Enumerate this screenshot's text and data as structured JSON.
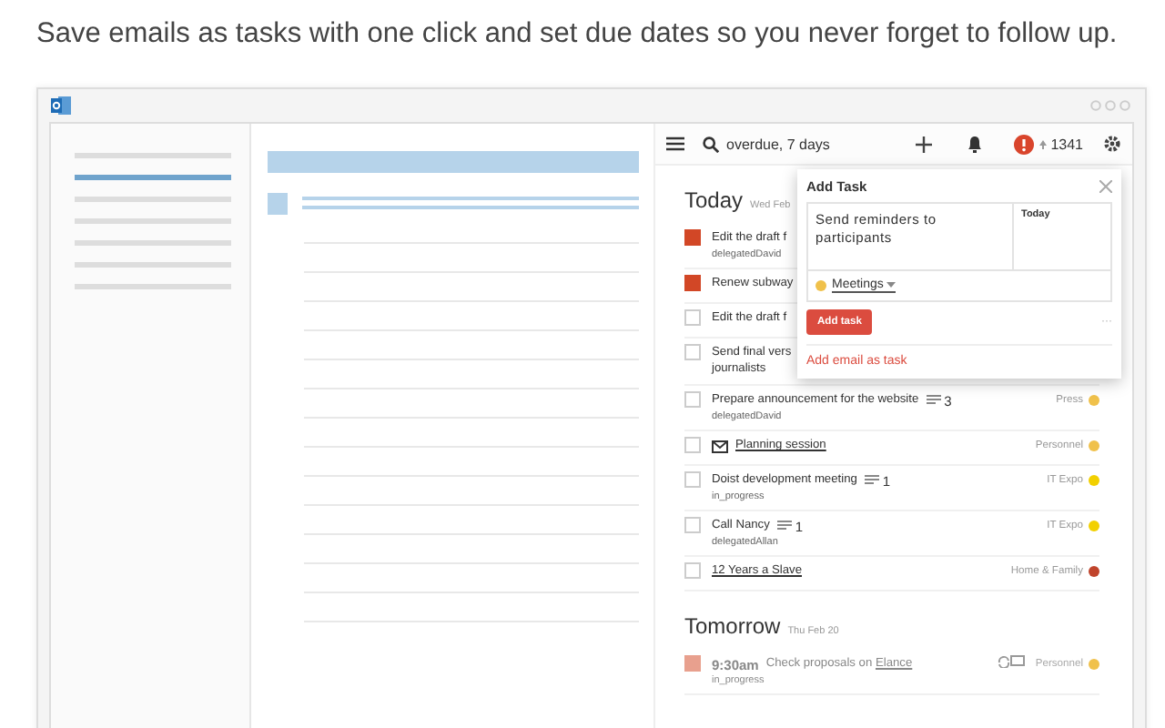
{
  "headline": "Save emails as tasks with one click and set due dates so you never forget to follow up.",
  "toolbar": {
    "search_value": "overdue, 7 days",
    "karma": "1341"
  },
  "sections": [
    {
      "title": "Today",
      "date": "Wed Feb",
      "tasks": [
        {
          "kind": "task",
          "title": "Edit the draft f",
          "high_priority": true,
          "sub": "delegatedDavid"
        },
        {
          "kind": "task",
          "title": "Renew subway",
          "high_priority": true
        },
        {
          "kind": "task",
          "title": "Edit the draft f",
          "high_priority": false
        },
        {
          "kind": "task",
          "title": "Send final vers",
          "title_line_2": "journalists",
          "high_priority": false
        },
        {
          "kind": "task",
          "title": "Prepare announcement for the website",
          "comments": "3",
          "sub": "delegatedDavid",
          "project": "Press",
          "color": "#f0c14b",
          "high_priority": false
        },
        {
          "kind": "email",
          "title": "Planning session",
          "project": "Personnel",
          "color": "#f0c14b",
          "high_priority": false
        },
        {
          "kind": "task",
          "title": "Doist development meeting",
          "comments": "1",
          "sub": "in_progress",
          "project": "IT Expo",
          "color": "#f2d000",
          "high_priority": false
        },
        {
          "kind": "task",
          "title": "Call Nancy",
          "comments": "1",
          "sub": "delegatedAllan",
          "project": "IT Expo",
          "color": "#f2d000",
          "high_priority": false
        },
        {
          "kind": "link",
          "title": "12 Years a Slave",
          "project": "Home & Family",
          "color": "#c0442c",
          "high_priority": false
        }
      ]
    },
    {
      "title": "Tomorrow",
      "date": "Thu Feb 20",
      "tasks": [
        {
          "kind": "timed",
          "time": "9:30am",
          "title": "Check proposals on ",
          "link": "Elance",
          "sub": "in_progress",
          "project": "Personnel",
          "color": "#f0c14b",
          "high_priority": true
        }
      ]
    }
  ],
  "add_task": {
    "title": "Add Task",
    "content": "Send reminders to participants",
    "date": "Today",
    "project": "Meetings",
    "button": "Add task",
    "more": "···",
    "email_link": "Add email as task"
  }
}
